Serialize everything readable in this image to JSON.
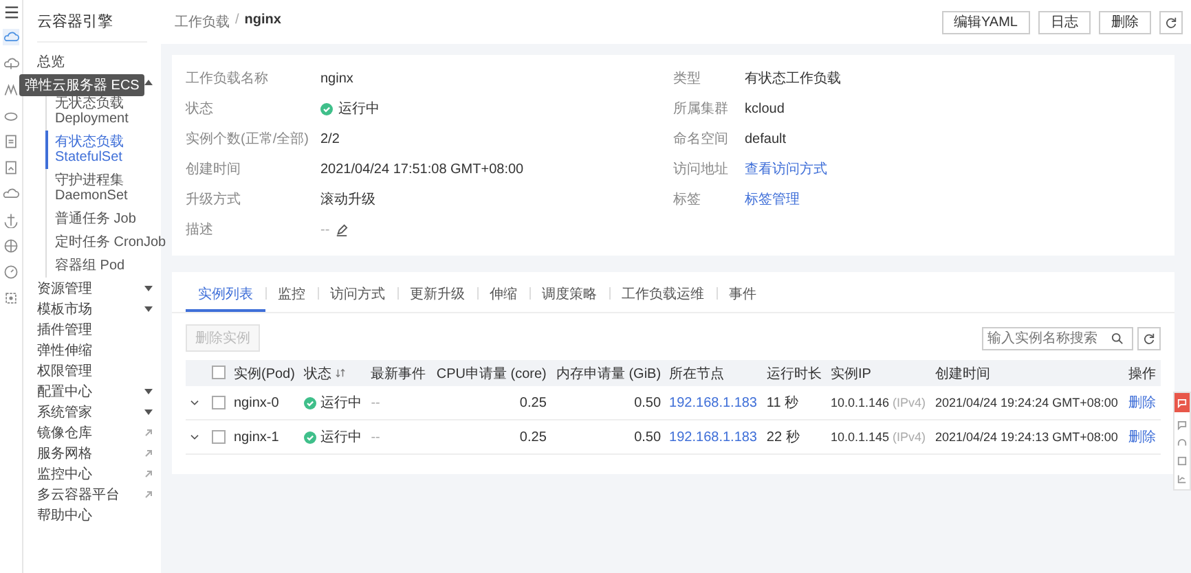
{
  "rail": {
    "tooltip": "弹性云服务器 ECS"
  },
  "sidebar": {
    "title": "云容器引擎",
    "items": [
      {
        "kind": "link",
        "label": "总览",
        "selected": false
      },
      {
        "kind": "group",
        "expanded": true,
        "children": [
          {
            "title": "无状态负载",
            "subtitle": "Deployment",
            "selected": false
          },
          {
            "title": "有状态负载",
            "subtitle": "StatefulSet",
            "selected": true
          },
          {
            "title": "守护进程集",
            "subtitle": "DaemonSet",
            "selected": false
          },
          {
            "title": "普通任务 Job",
            "selected": false
          },
          {
            "title": "定时任务 CronJob",
            "selected": false
          },
          {
            "title": "容器组 Pod",
            "selected": false
          }
        ]
      },
      {
        "kind": "group",
        "label": "资源管理",
        "expanded": false
      },
      {
        "kind": "group",
        "label": "模板市场",
        "expanded": false
      },
      {
        "kind": "link",
        "label": "插件管理",
        "selected": false
      },
      {
        "kind": "link",
        "label": "弹性伸缩",
        "selected": false
      },
      {
        "kind": "link",
        "label": "权限管理",
        "selected": false
      },
      {
        "kind": "group",
        "label": "配置中心",
        "expanded": false
      },
      {
        "kind": "group",
        "label": "系统管家",
        "expanded": false
      },
      {
        "kind": "external",
        "label": "镜像仓库"
      },
      {
        "kind": "external",
        "label": "服务网格"
      },
      {
        "kind": "external",
        "label": "监控中心"
      },
      {
        "kind": "external",
        "label": "多云容器平台"
      },
      {
        "kind": "link",
        "label": "帮助中心",
        "selected": false
      }
    ]
  },
  "breadcrumb": [
    "工作负载",
    "/",
    "nginx"
  ],
  "header_buttons": [
    "编辑YAML",
    "日志",
    "删除"
  ],
  "details": {
    "left": [
      {
        "label": "工作负载名称",
        "value": "nginx",
        "kind": "text"
      },
      {
        "label": "状态",
        "value": "运行中",
        "kind": "status"
      },
      {
        "label": "实例个数(正常/全部)",
        "value": "2/2",
        "kind": "text"
      },
      {
        "label": "创建时间",
        "value": "2021/04/24 17:51:08 GMT+08:00",
        "kind": "text"
      },
      {
        "label": "升级方式",
        "value": "滚动升级",
        "kind": "text"
      },
      {
        "label": "描述",
        "value": "--",
        "kind": "editable"
      }
    ],
    "right": [
      {
        "label": "类型",
        "value": "有状态工作负载",
        "kind": "text"
      },
      {
        "label": "所属集群",
        "value": "kcloud",
        "kind": "text"
      },
      {
        "label": "命名空间",
        "value": "default",
        "kind": "text"
      },
      {
        "label": "访问地址",
        "value": "查看访问方式",
        "kind": "link"
      },
      {
        "label": "标签",
        "value": "标签管理",
        "kind": "link"
      }
    ]
  },
  "tabs": [
    {
      "label": "实例列表",
      "selected": true
    },
    {
      "label": "监控",
      "selected": false
    },
    {
      "label": "访问方式",
      "selected": false
    },
    {
      "label": "更新升级",
      "selected": false
    },
    {
      "label": "伸缩",
      "selected": false
    },
    {
      "label": "调度策略",
      "selected": false
    },
    {
      "label": "工作负载运维",
      "selected": false
    },
    {
      "label": "事件",
      "selected": false
    }
  ],
  "delete_button": {
    "label": "删除实例",
    "disabled": true
  },
  "search": {
    "placeholder": "输入实例名称搜索"
  },
  "table": {
    "header_checked": false,
    "columns": [
      "实例(Pod)",
      "状态",
      "最新事件",
      "CPU申请量 (core)",
      "内存申请量 (GiB)",
      "所在节点",
      "运行时长",
      "实例IP",
      "创建时间",
      "操作"
    ],
    "rows": [
      {
        "expanded": false,
        "checked": false,
        "pod": "nginx-0",
        "status": "运行中",
        "event": "--",
        "cpu": "0.25",
        "memory": "0.50",
        "node": "192.168.1.183",
        "uptime": "11 秒",
        "ip": "10.0.1.146",
        "ip_type": "(IPv4)",
        "created": "2021/04/24 19:24:24 GMT+08:00",
        "action": "删除"
      },
      {
        "expanded": false,
        "checked": false,
        "pod": "nginx-1",
        "status": "运行中",
        "event": "--",
        "cpu": "0.25",
        "memory": "0.50",
        "node": "192.168.1.183",
        "uptime": "22 秒",
        "ip": "10.0.1.145",
        "ip_type": "(IPv4)",
        "created": "2021/04/24 19:24:13 GMT+08:00",
        "action": "删除"
      }
    ]
  }
}
